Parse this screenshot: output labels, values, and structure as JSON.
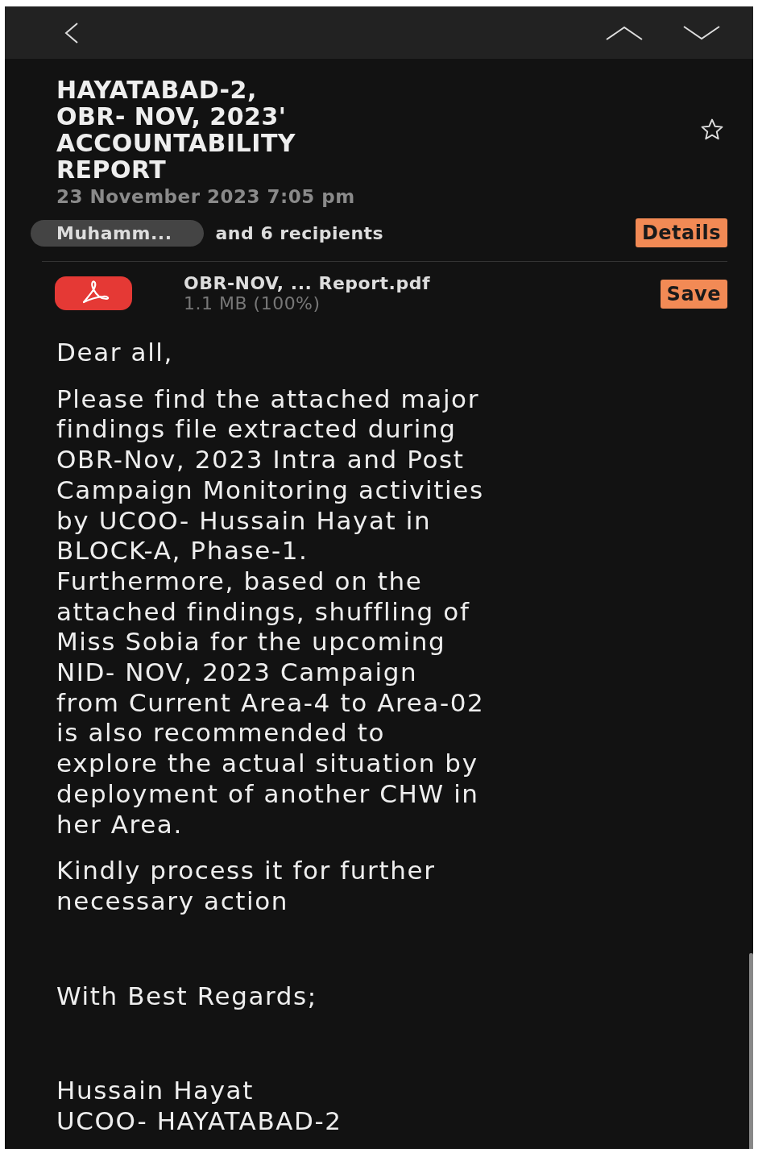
{
  "subject": "HAYATABAD-2,\nOBR- NOV, 2023'\nACCOUNTABILITY\nREPORT",
  "starred": false,
  "date": "23 November 2023  7:05 pm",
  "sender": "Muhamm...",
  "recipients": "and 6 recipients",
  "details_button": "Details",
  "attachment": {
    "name": "OBR-NOV, ... Report.pdf",
    "size": "1.1 MB (100%)",
    "save_button": "Save"
  },
  "body": [
    {
      "kind": "text",
      "text": "Dear all,"
    },
    {
      "kind": "text",
      "text": "Please find the attached major\nfindings file extracted during\nOBR-Nov, 2023 Intra and Post\nCampaign Monitoring activities\nby UCOO- Hussain Hayat in\nBLOCK-A, Phase-1.\nFurthermore, based on the\nattached findings, shuffling of\nMiss Sobia for the upcoming\nNID- NOV, 2023 Campaign\nfrom Current Area-4 to Area-02\nis also recommended to\nexplore the actual situation by\ndeployment of another CHW in\nher Area."
    },
    {
      "kind": "text",
      "text": "Kindly process it for further\nnecessary action"
    },
    {
      "kind": "gap"
    },
    {
      "kind": "text",
      "text": "With Best Regards;"
    },
    {
      "kind": "gap"
    },
    {
      "kind": "text",
      "text": "Hussain Hayat\nUCOO- HAYATABAD-2"
    }
  ]
}
